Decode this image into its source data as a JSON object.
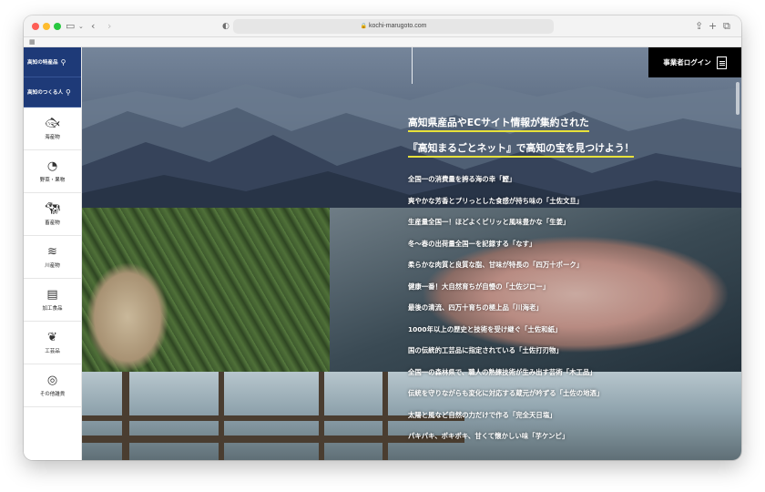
{
  "browser": {
    "url": "kochi-marugoto.com"
  },
  "sidebar": {
    "search_items": [
      {
        "label": "高知の特産品"
      },
      {
        "label": "高知のつくる人"
      }
    ],
    "categories": [
      {
        "label": "海産物",
        "icon": "fish-icon"
      },
      {
        "label": "野菜・果物",
        "icon": "fruit-icon"
      },
      {
        "label": "畜産物",
        "icon": "cow-icon"
      },
      {
        "label": "川産物",
        "icon": "river-waves-icon"
      },
      {
        "label": "加工食品",
        "icon": "jar-icon"
      },
      {
        "label": "工芸品",
        "icon": "leaf-craft-icon"
      },
      {
        "label": "その他雑貨",
        "icon": "circle-misc-icon"
      }
    ]
  },
  "header": {
    "login_label": "事業者ログイン"
  },
  "hero": {
    "headline_line1": "高知県産品やECサイト情報が集約された",
    "headline_line2": "『高知まるごとネット』で高知の宝を見つけよう！",
    "accent_color": "#e8e23a",
    "items": [
      "全国一の消費量を誇る海の幸「鰹」",
      "爽やかな芳香とプリっとした食感が持ち味の「土佐文旦」",
      "生産量全国一！ほどよくピリッと風味豊かな「生姜」",
      "冬～春の出荷量全国一を記録する「なす」",
      "柔らかな肉質と良質な脂、甘味が特長の「四万十ポーク」",
      "健康一番！大自然育ちが自慢の「土佐ジロー」",
      "最後の清流、四万十育ちの極上品「川海老」",
      "1000年以上の歴史と技術を受け継ぐ「土佐和紙」",
      "国の伝統的工芸品に指定されている「土佐打刃物」",
      "全国一の森林県で、職人の熟練技術が生み出す芸術「木工品」",
      "伝統を守りながらも変化に対応する蔵元が吟ずる「土佐の地酒」",
      "太陽と風など自然の力だけで作る「完全天日塩」",
      "パキパキ、ポキポキ、甘くて懐かしい味「芋ケンピ」"
    ]
  }
}
